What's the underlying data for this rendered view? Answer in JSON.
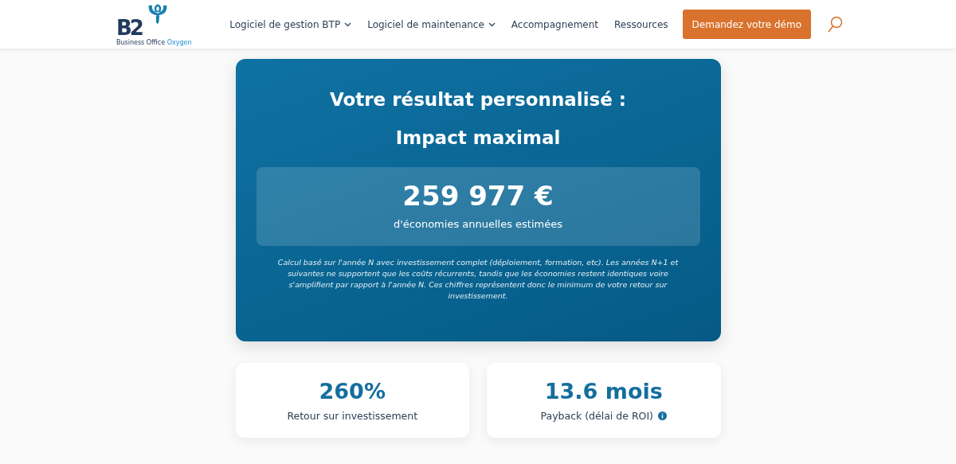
{
  "header": {
    "logo": {
      "mark": "B2",
      "tagline_part1": "Business Office",
      "tagline_part2": "Oxygen"
    },
    "nav": [
      {
        "label": "Logiciel de gestion BTP",
        "dropdown": true
      },
      {
        "label": "Logiciel de maintenance",
        "dropdown": true
      },
      {
        "label": "Accompagnement",
        "dropdown": false
      },
      {
        "label": "Ressources",
        "dropdown": false
      }
    ],
    "cta": "Demandez votre démo"
  },
  "result": {
    "title": "Votre résultat personnalisé :",
    "subtitle": "Impact maximal",
    "amount": "259 977 €",
    "amount_caption": "d'économies annuelles estimées",
    "note": "Calcul basé sur l'année N avec investissement complet (déploiement, formation, etc). Les années N+1 et suivantes ne supportent que les coûts récurrents, tandis que les économies restent identiques voire s'amplifient par rapport à l'année N. Ces chiffres représentent donc le minimum de votre retour sur investissement."
  },
  "stats": [
    {
      "value": "260%",
      "label": "Retour sur investissement",
      "info": false
    },
    {
      "value": "13.6 mois",
      "label": "Payback (délai de ROI)",
      "info": true
    }
  ]
}
